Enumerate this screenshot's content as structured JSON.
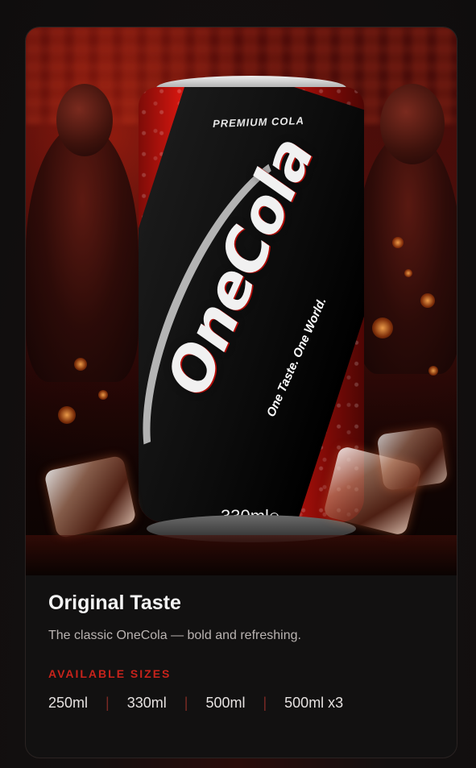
{
  "product": {
    "name": "Original Taste",
    "description": "The classic OneCola — bold and refreshing.",
    "can": {
      "label_top": "PREMIUM COLA",
      "brand": "OneCola",
      "slogan": "One Taste. One World.",
      "volume": "330ml℮"
    }
  },
  "sizes": {
    "heading": "AVAILABLE SIZES",
    "options": [
      "250ml",
      "330ml",
      "500ml",
      "500ml x3"
    ],
    "separator": "|"
  },
  "colors": {
    "accent": "#c8231b",
    "can_red": "#e8201a",
    "card_bg": "#121111",
    "page_bg": "#0f0d0d"
  }
}
